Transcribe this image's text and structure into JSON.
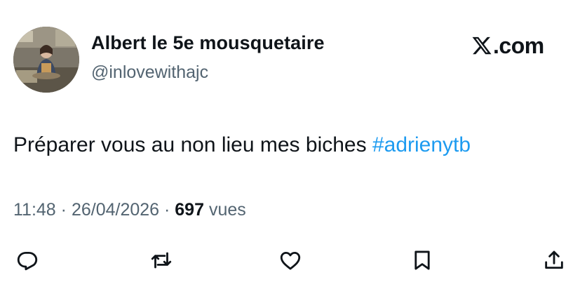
{
  "author": {
    "display_name": "Albert le 5e mousquetaire",
    "handle": "@inlovewithajc"
  },
  "brand": {
    "text": ".com",
    "logo_icon": "x-logo-icon"
  },
  "tweet": {
    "text": "Préparer vous au non lieu mes biches ",
    "hashtag": "#adrienytb"
  },
  "meta": {
    "time": "11:48",
    "sep1": " · ",
    "date": "26/04/2026",
    "sep2": " · ",
    "views_count": "697",
    "views_label": " vues"
  },
  "actions": [
    {
      "name": "reply",
      "icon": "reply-icon"
    },
    {
      "name": "repost",
      "icon": "repost-icon"
    },
    {
      "name": "like",
      "icon": "heart-icon"
    },
    {
      "name": "bookmark",
      "icon": "bookmark-icon"
    },
    {
      "name": "share",
      "icon": "share-icon"
    }
  ],
  "colors": {
    "text": "#0f1419",
    "secondary": "#536471",
    "link": "#1d9bf0",
    "background": "#ffffff"
  }
}
